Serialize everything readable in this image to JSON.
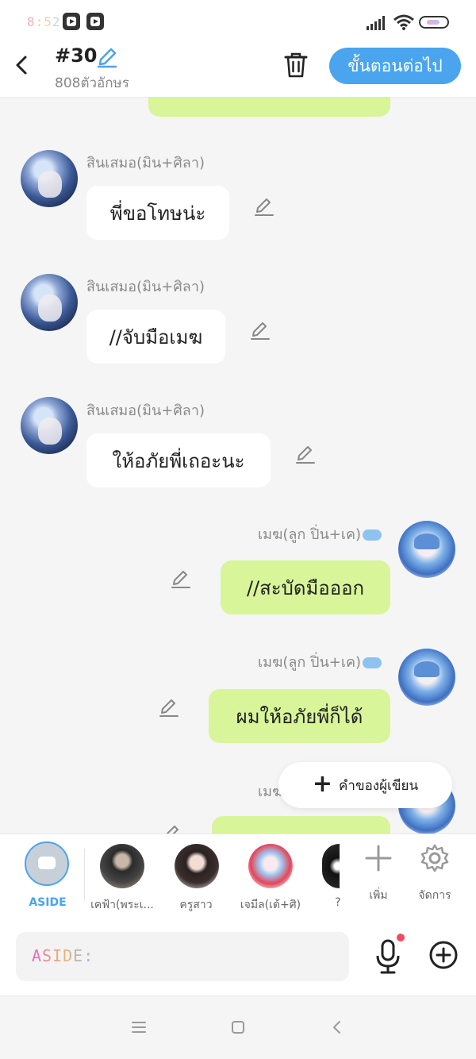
{
  "status_bar": {
    "time": "8:52"
  },
  "header": {
    "title": "#30",
    "char_count": "808ตัวอักษร",
    "next_label": "ขั้นตอนต่อไป"
  },
  "messages": [
    {
      "side": "left",
      "name": "สินเสมอ(มิน+ศิลา)",
      "text": "พี่ขอโทษน่ะ"
    },
    {
      "side": "left",
      "name": "สินเสมอ(มิน+ศิลา)",
      "text": "//จับมือเมฆ"
    },
    {
      "side": "left",
      "name": "สินเสมอ(มิน+ศิลา)",
      "text": "ให้อภัยพี่เถอะนะ"
    },
    {
      "side": "right",
      "name": "เมฆ(ลูก ปิ่น+เค)",
      "text": "//สะบัดมือออก"
    },
    {
      "side": "right",
      "name": "เมฆ(ลูก ปิ่น+เค)",
      "text": "ผมให้อภัยพี่ก็ได้"
    },
    {
      "side": "right",
      "name_partial": "เมฆ"
    }
  ],
  "fab": {
    "label": "คำของผู้เขียน"
  },
  "characters": {
    "aside_label": "ASIDE",
    "items": [
      {
        "label": "เคฟ้า(พระเ..."
      },
      {
        "label": "ครูสาว"
      },
      {
        "label": "เจมีล(เต้+ศิ)"
      },
      {
        "label": "?"
      }
    ],
    "add_label": "เพิ่ม",
    "manage_label": "จัดการ"
  },
  "input": {
    "prefix": "ASIDE:",
    "value": ""
  },
  "colors": {
    "accent": "#4aa4ee",
    "bubble_green": "#d8f59a",
    "bubble_white": "#ffffff"
  }
}
